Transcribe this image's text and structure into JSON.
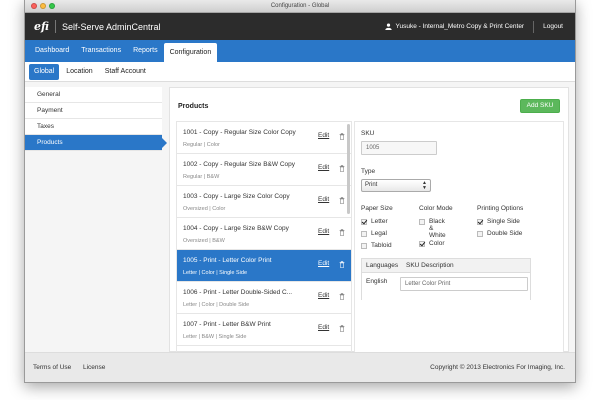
{
  "window": {
    "title": "Configuration - Global"
  },
  "header": {
    "logo": "efi",
    "app_title": "Self-Serve AdminCentral",
    "user": "Yusuke - Internal_Metro Copy & Print Center",
    "logout": "Logout"
  },
  "main_nav": [
    {
      "label": "Dashboard"
    },
    {
      "label": "Transactions"
    },
    {
      "label": "Reports"
    },
    {
      "label": "Configuration",
      "active": true
    }
  ],
  "sub_nav": [
    {
      "label": "Global",
      "active": true
    },
    {
      "label": "Location"
    },
    {
      "label": "Staff Account"
    }
  ],
  "sidebar": [
    {
      "label": "General"
    },
    {
      "label": "Payment"
    },
    {
      "label": "Taxes"
    },
    {
      "label": "Products",
      "active": true
    }
  ],
  "products": {
    "title": "Products",
    "add_button": "Add SKU",
    "edit_label": "Edit",
    "items": [
      {
        "name": "1001 - Copy - Regular Size Color Copy",
        "desc": "Regular | Color"
      },
      {
        "name": "1002 - Copy - Regular Size B&W Copy",
        "desc": "Regular | B&W"
      },
      {
        "name": "1003 - Copy - Large Size Color Copy",
        "desc": "Oversized | Color"
      },
      {
        "name": "1004 - Copy - Large Size B&W Copy",
        "desc": "Oversized | B&W"
      },
      {
        "name": "1005 - Print - Letter Color Print",
        "desc": "Letter | Color | Single Side",
        "selected": true
      },
      {
        "name": "1006 - Print - Letter Double-Sided C...",
        "desc": "Letter | Color | Double Side"
      },
      {
        "name": "1007 - Print - Letter B&W Print",
        "desc": "Letter | B&W | Single Side"
      }
    ]
  },
  "detail": {
    "sku_label": "SKU",
    "sku_value": "1005",
    "type_label": "Type",
    "type_value": "Print",
    "paper_size_label": "Paper Size",
    "paper_sizes": [
      {
        "label": "Letter",
        "checked": true
      },
      {
        "label": "Legal",
        "checked": false
      },
      {
        "label": "Tabloid",
        "checked": false
      }
    ],
    "color_mode_label": "Color Mode",
    "color_modes": [
      {
        "label": "Black & White",
        "checked": false
      },
      {
        "label": "Color",
        "checked": true
      }
    ],
    "printing_options_label": "Printing Options",
    "printing_options": [
      {
        "label": "Single Side",
        "checked": true
      },
      {
        "label": "Double Side",
        "checked": false
      }
    ],
    "languages_label": "Languages",
    "sku_desc_label": "SKU Description",
    "language": "English",
    "description": "Letter Color Print"
  },
  "footer": {
    "terms": "Terms of Use",
    "license": "License",
    "copyright": "Copyright © 2013 Electronics For Imaging, Inc."
  }
}
